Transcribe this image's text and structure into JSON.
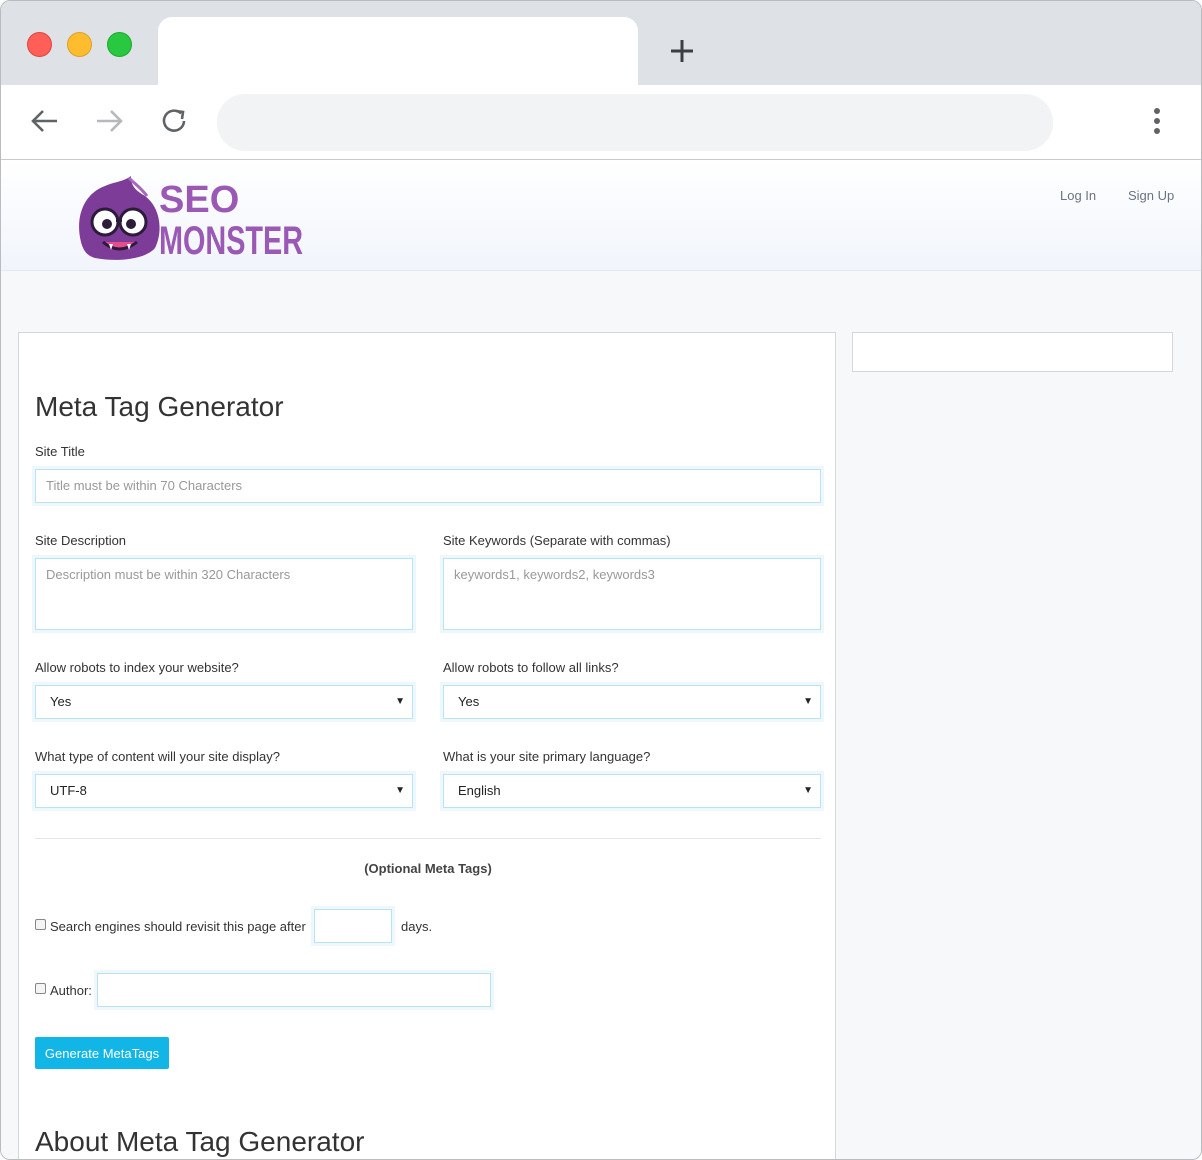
{
  "browser": {
    "url": "",
    "tab_title": ""
  },
  "header": {
    "logo_line1": "SEO",
    "logo_line2": "MONSTER",
    "login": "Log In",
    "signup": "Sign Up"
  },
  "form": {
    "title": "Meta Tag Generator",
    "site_title_label": "Site Title",
    "site_title_placeholder": "Title must be within 70 Characters",
    "description_label": "Site Description",
    "description_placeholder": "Description must be within 320 Characters",
    "keywords_label": "Site Keywords (Separate with commas)",
    "keywords_placeholder": "keywords1, keywords2, keywords3",
    "index_label": "Allow robots to index your website?",
    "index_value": "Yes",
    "follow_label": "Allow robots to follow all links?",
    "follow_value": "Yes",
    "content_label": "What type of content will your site display?",
    "content_value": "UTF-8",
    "language_label": "What is your site primary language?",
    "language_value": "English",
    "optional_heading": "(Optional Meta Tags)",
    "revisit_label": "Search engines should revisit this page after",
    "revisit_suffix": "days.",
    "author_label": "Author:",
    "generate_button": "Generate MetaTags",
    "about_title": "About Meta Tag Generator"
  },
  "colors": {
    "logo_purple": "#9b59b6",
    "button": "#12b6e6"
  }
}
